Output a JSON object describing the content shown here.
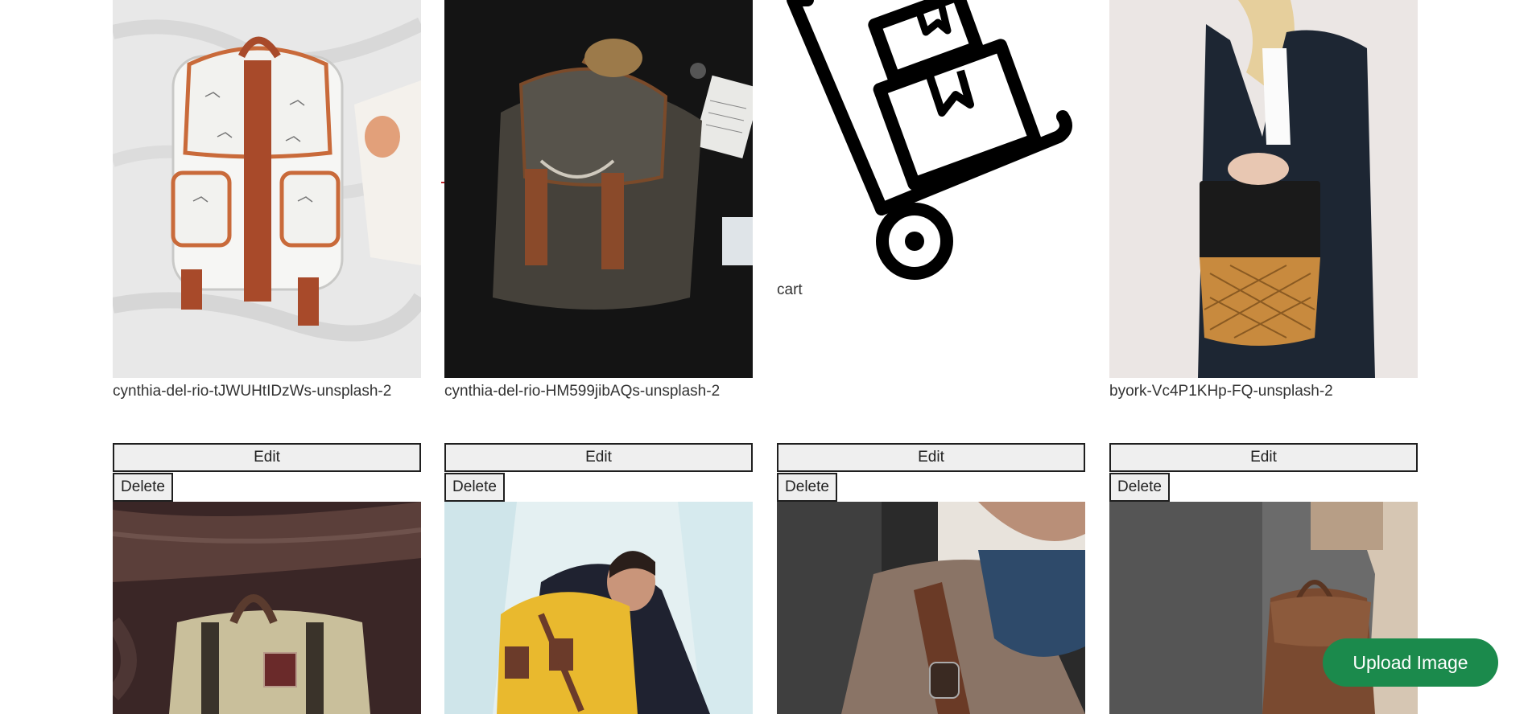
{
  "gallery": {
    "row1": [
      {
        "caption": "cynthia-del-rio-tJWUHtIDzWs-unsplash-2",
        "image_icon": "white-elephant-print-backpack-photo"
      },
      {
        "caption": "cynthia-del-rio-HM599jibAQs-unsplash-2",
        "image_icon": "dark-canvas-backpack-photo"
      },
      {
        "caption": "cart",
        "image_icon": "hand-truck-boxes-icon"
      },
      {
        "caption": "byork-Vc4P1KHp-FQ-unsplash-2",
        "image_icon": "woman-with-woven-bag-photo"
      }
    ],
    "row2": [
      {
        "edit_label": "Edit",
        "delete_label": "Delete",
        "image_icon": "beige-messenger-bag-photo"
      },
      {
        "edit_label": "Edit",
        "delete_label": "Delete",
        "image_icon": "yellow-backpack-photo"
      },
      {
        "edit_label": "Edit",
        "delete_label": "Delete",
        "image_icon": "man-leather-strap-photo"
      },
      {
        "edit_label": "Edit",
        "delete_label": "Delete",
        "image_icon": "brown-leather-backpack-photo"
      }
    ]
  },
  "upload_button": {
    "label": "Upload Image",
    "color": "#1b8a4c"
  }
}
